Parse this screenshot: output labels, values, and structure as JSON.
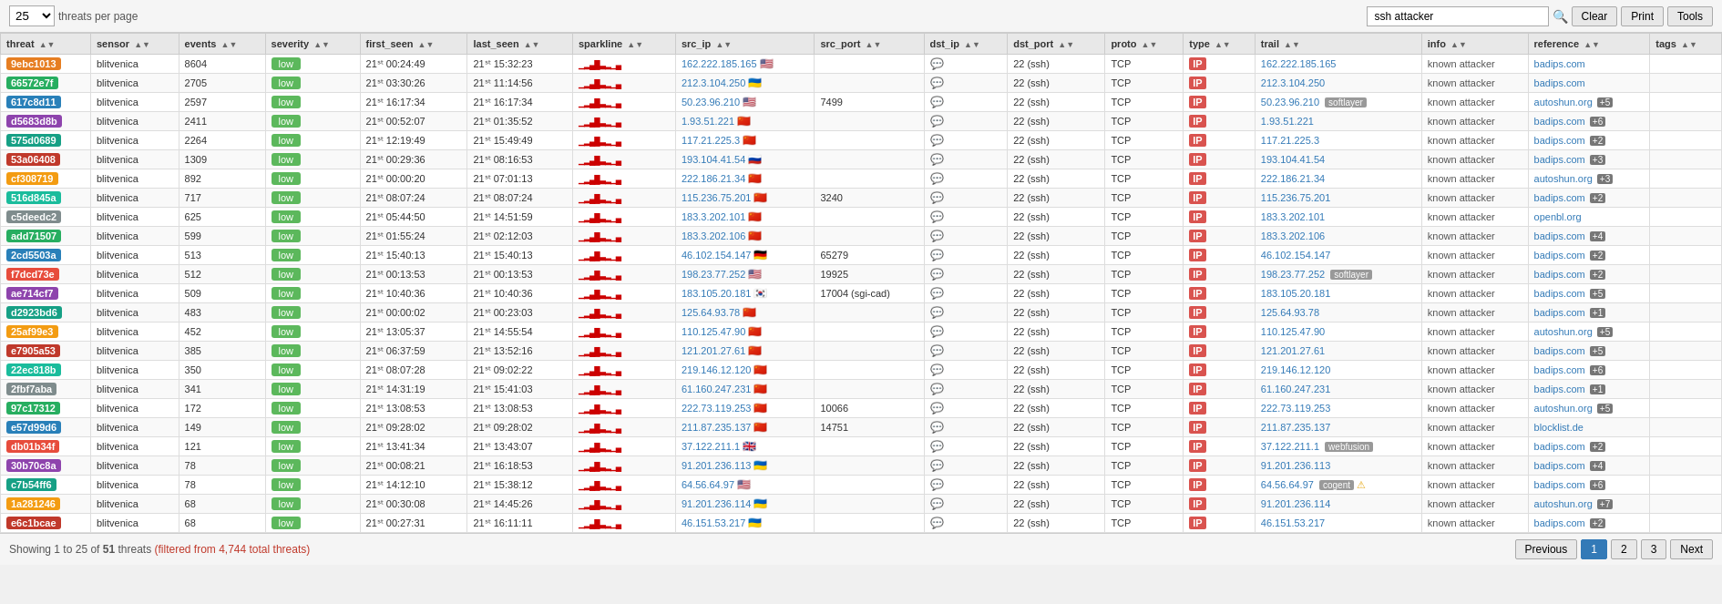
{
  "topbar": {
    "per_page_value": "25",
    "per_page_label": "threats per page",
    "search_placeholder": "ssh attacker",
    "search_value": "ssh attacker",
    "btn_clear": "Clear",
    "btn_print": "Print",
    "btn_tools": "Tools"
  },
  "columns": [
    {
      "key": "threat",
      "label": "threat"
    },
    {
      "key": "sensor",
      "label": "sensor"
    },
    {
      "key": "events",
      "label": "events"
    },
    {
      "key": "severity",
      "label": "severity"
    },
    {
      "key": "first_seen",
      "label": "first_seen"
    },
    {
      "key": "last_seen",
      "label": "last_seen"
    },
    {
      "key": "sparkline",
      "label": "sparkline"
    },
    {
      "key": "src_ip",
      "label": "src_ip"
    },
    {
      "key": "src_port",
      "label": "src_port"
    },
    {
      "key": "dst_ip",
      "label": "dst_ip"
    },
    {
      "key": "dst_port",
      "label": "dst_port"
    },
    {
      "key": "proto",
      "label": "proto"
    },
    {
      "key": "type",
      "label": "type"
    },
    {
      "key": "trail",
      "label": "trail"
    },
    {
      "key": "info",
      "label": "info"
    },
    {
      "key": "reference",
      "label": "reference"
    },
    {
      "key": "tags",
      "label": "tags"
    }
  ],
  "rows": [
    {
      "threat": "9ebc1013",
      "threat_color": "#e67e22",
      "sensor": "blitvenica",
      "events": "8604",
      "severity": "low",
      "first_seen": "21ˢᵗ 00:24:49",
      "last_seen": "21ˢᵗ 15:32:23",
      "src_ip": "162.222.185.165",
      "src_ip_flag": "US",
      "src_port": "",
      "dst_ip": "",
      "dst_port": "22 (ssh)",
      "proto": "TCP",
      "trail": "162.222.185.165",
      "info": "known attacker",
      "reference": "badips.com",
      "ref_extra": ""
    },
    {
      "threat": "66572e7f",
      "threat_color": "#27ae60",
      "sensor": "blitvenica",
      "events": "2705",
      "severity": "low",
      "first_seen": "21ˢᵗ 03:30:26",
      "last_seen": "21ˢᵗ 11:14:56",
      "src_ip": "212.3.104.250",
      "src_ip_flag": "UA",
      "src_port": "",
      "dst_ip": "",
      "dst_port": "22 (ssh)",
      "proto": "TCP",
      "trail": "212.3.104.250",
      "info": "known attacker",
      "reference": "badips.com",
      "ref_extra": ""
    },
    {
      "threat": "617c8d11",
      "threat_color": "#2980b9",
      "sensor": "blitvenica",
      "events": "2597",
      "severity": "low",
      "first_seen": "21ˢᵗ 16:17:34",
      "last_seen": "21ˢᵗ 16:17:34",
      "src_ip": "50.23.96.210",
      "src_ip_flag": "US",
      "src_port": "7499",
      "dst_ip": "",
      "dst_port": "22 (ssh)",
      "proto": "TCP",
      "trail": "50.23.96.210",
      "trail_badge": "softlayer",
      "info": "known attacker",
      "reference": "autoshun.org",
      "ref_extra": "+5"
    },
    {
      "threat": "d5683d8b",
      "threat_color": "#8e44ad",
      "sensor": "blitvenica",
      "events": "2411",
      "severity": "low",
      "first_seen": "21ˢᵗ 00:52:07",
      "last_seen": "21ˢᵗ 01:35:52",
      "src_ip": "1.93.51.221",
      "src_ip_flag": "CN",
      "src_port": "",
      "dst_ip": "",
      "dst_port": "22 (ssh)",
      "proto": "TCP",
      "trail": "1.93.51.221",
      "info": "known attacker",
      "reference": "badips.com",
      "ref_extra": "+6"
    },
    {
      "threat": "575d0689",
      "threat_color": "#16a085",
      "sensor": "blitvenica",
      "events": "2264",
      "severity": "low",
      "first_seen": "21ˢᵗ 12:19:49",
      "last_seen": "21ˢᵗ 15:49:49",
      "src_ip": "117.21.225.3",
      "src_ip_flag": "CN",
      "src_port": "",
      "dst_ip": "",
      "dst_port": "22 (ssh)",
      "proto": "TCP",
      "trail": "117.21.225.3",
      "info": "known attacker",
      "reference": "badips.com",
      "ref_extra": "+2"
    },
    {
      "threat": "53a06408",
      "threat_color": "#c0392b",
      "sensor": "blitvenica",
      "events": "1309",
      "severity": "low",
      "first_seen": "21ˢᵗ 00:29:36",
      "last_seen": "21ˢᵗ 08:16:53",
      "src_ip": "193.104.41.54",
      "src_ip_flag": "RU",
      "src_port": "",
      "dst_ip": "",
      "dst_port": "22 (ssh)",
      "proto": "TCP",
      "trail": "193.104.41.54",
      "info": "known attacker",
      "reference": "badips.com",
      "ref_extra": "+3"
    },
    {
      "threat": "cf308719",
      "threat_color": "#f39c12",
      "sensor": "blitvenica",
      "events": "892",
      "severity": "low",
      "first_seen": "21ˢᵗ 00:00:20",
      "last_seen": "21ˢᵗ 07:01:13",
      "src_ip": "222.186.21.34",
      "src_ip_flag": "CN",
      "src_port": "",
      "dst_ip": "",
      "dst_port": "22 (ssh)",
      "proto": "TCP",
      "trail": "222.186.21.34",
      "info": "known attacker",
      "reference": "autoshun.org",
      "ref_extra": "+3"
    },
    {
      "threat": "516d845a",
      "threat_color": "#1abc9c",
      "sensor": "blitvenica",
      "events": "717",
      "severity": "low",
      "first_seen": "21ˢᵗ 08:07:24",
      "last_seen": "21ˢᵗ 08:07:24",
      "src_ip": "115.236.75.201",
      "src_ip_flag": "CN",
      "src_port": "3240",
      "dst_ip": "",
      "dst_port": "22 (ssh)",
      "proto": "TCP",
      "trail": "115.236.75.201",
      "info": "known attacker",
      "reference": "badips.com",
      "ref_extra": "+2"
    },
    {
      "threat": "c5deedc2",
      "threat_color": "#7f8c8d",
      "sensor": "blitvenica",
      "events": "625",
      "severity": "low",
      "first_seen": "21ˢᵗ 05:44:50",
      "last_seen": "21ˢᵗ 14:51:59",
      "src_ip": "183.3.202.101",
      "src_ip_flag": "CN",
      "src_port": "",
      "dst_ip": "",
      "dst_port": "22 (ssh)",
      "proto": "TCP",
      "trail": "183.3.202.101",
      "info": "known attacker",
      "reference": "openbl.org",
      "ref_extra": ""
    },
    {
      "threat": "add71507",
      "threat_color": "#27ae60",
      "sensor": "blitvenica",
      "events": "599",
      "severity": "low",
      "first_seen": "21ˢᵗ 01:55:24",
      "last_seen": "21ˢᵗ 02:12:03",
      "src_ip": "183.3.202.106",
      "src_ip_flag": "CN",
      "src_port": "",
      "dst_ip": "",
      "dst_port": "22 (ssh)",
      "proto": "TCP",
      "trail": "183.3.202.106",
      "info": "known attacker",
      "reference": "badips.com",
      "ref_extra": "+4"
    },
    {
      "threat": "2cd5503a",
      "threat_color": "#2980b9",
      "sensor": "blitvenica",
      "events": "513",
      "severity": "low",
      "first_seen": "21ˢᵗ 15:40:13",
      "last_seen": "21ˢᵗ 15:40:13",
      "src_ip": "46.102.154.147",
      "src_ip_flag": "DE",
      "src_port": "65279",
      "dst_ip": "",
      "dst_port": "22 (ssh)",
      "proto": "TCP",
      "trail": "46.102.154.147",
      "info": "known attacker",
      "reference": "badips.com",
      "ref_extra": "+2"
    },
    {
      "threat": "f7dcd73e",
      "threat_color": "#e74c3c",
      "sensor": "blitvenica",
      "events": "512",
      "severity": "low",
      "first_seen": "21ˢᵗ 00:13:53",
      "last_seen": "21ˢᵗ 00:13:53",
      "src_ip": "198.23.77.252",
      "src_ip_flag": "US",
      "src_port": "19925",
      "dst_ip": "",
      "dst_port": "22 (ssh)",
      "proto": "TCP",
      "trail": "198.23.77.252",
      "trail_badge": "softlayer",
      "info": "known attacker",
      "reference": "badips.com",
      "ref_extra": "+2"
    },
    {
      "threat": "ae714cf7",
      "threat_color": "#8e44ad",
      "sensor": "blitvenica",
      "events": "509",
      "severity": "low",
      "first_seen": "21ˢᵗ 10:40:36",
      "last_seen": "21ˢᵗ 10:40:36",
      "src_ip": "183.105.20.181",
      "src_ip_flag": "KR",
      "src_port": "17004 (sgi-cad)",
      "dst_ip": "",
      "dst_port": "22 (ssh)",
      "proto": "TCP",
      "trail": "183.105.20.181",
      "info": "known attacker",
      "reference": "badips.com",
      "ref_extra": "+5"
    },
    {
      "threat": "d2923bd6",
      "threat_color": "#16a085",
      "sensor": "blitvenica",
      "events": "483",
      "severity": "low",
      "first_seen": "21ˢᵗ 00:00:02",
      "last_seen": "21ˢᵗ 00:23:03",
      "src_ip": "125.64.93.78",
      "src_ip_flag": "CN",
      "src_port": "",
      "dst_ip": "",
      "dst_port": "22 (ssh)",
      "proto": "TCP",
      "trail": "125.64.93.78",
      "info": "known attacker",
      "reference": "badips.com",
      "ref_extra": "+1"
    },
    {
      "threat": "25af99e3",
      "threat_color": "#f39c12",
      "sensor": "blitvenica",
      "events": "452",
      "severity": "low",
      "first_seen": "21ˢᵗ 13:05:37",
      "last_seen": "21ˢᵗ 14:55:54",
      "src_ip": "110.125.47.90",
      "src_ip_flag": "CN",
      "src_port": "",
      "dst_ip": "",
      "dst_port": "22 (ssh)",
      "proto": "TCP",
      "trail": "110.125.47.90",
      "info": "known attacker",
      "reference": "autoshun.org",
      "ref_extra": "+5"
    },
    {
      "threat": "e7905a53",
      "threat_color": "#c0392b",
      "sensor": "blitvenica",
      "events": "385",
      "severity": "low",
      "first_seen": "21ˢᵗ 06:37:59",
      "last_seen": "21ˢᵗ 13:52:16",
      "src_ip": "121.201.27.61",
      "src_ip_flag": "CN",
      "src_port": "",
      "dst_ip": "",
      "dst_port": "22 (ssh)",
      "proto": "TCP",
      "trail": "121.201.27.61",
      "info": "known attacker",
      "reference": "badips.com",
      "ref_extra": "+5"
    },
    {
      "threat": "22ec818b",
      "threat_color": "#1abc9c",
      "sensor": "blitvenica",
      "events": "350",
      "severity": "low",
      "first_seen": "21ˢᵗ 08:07:28",
      "last_seen": "21ˢᵗ 09:02:22",
      "src_ip": "219.146.12.120",
      "src_ip_flag": "CN",
      "src_port": "",
      "dst_ip": "",
      "dst_port": "22 (ssh)",
      "proto": "TCP",
      "trail": "219.146.12.120",
      "info": "known attacker",
      "reference": "badips.com",
      "ref_extra": "+6"
    },
    {
      "threat": "2fbf7aba",
      "threat_color": "#7f8c8d",
      "sensor": "blitvenica",
      "events": "341",
      "severity": "low",
      "first_seen": "21ˢᵗ 14:31:19",
      "last_seen": "21ˢᵗ 15:41:03",
      "src_ip": "61.160.247.231",
      "src_ip_flag": "CN",
      "src_port": "",
      "dst_ip": "",
      "dst_port": "22 (ssh)",
      "proto": "TCP",
      "trail": "61.160.247.231",
      "info": "known attacker",
      "reference": "badips.com",
      "ref_extra": "+1"
    },
    {
      "threat": "97c17312",
      "threat_color": "#27ae60",
      "sensor": "blitvenica",
      "events": "172",
      "severity": "low",
      "first_seen": "21ˢᵗ 13:08:53",
      "last_seen": "21ˢᵗ 13:08:53",
      "src_ip": "222.73.119.253",
      "src_ip_flag": "CN",
      "src_port": "10066",
      "dst_ip": "",
      "dst_port": "22 (ssh)",
      "proto": "TCP",
      "trail": "222.73.119.253",
      "info": "known attacker",
      "reference": "autoshun.org",
      "ref_extra": "+5"
    },
    {
      "threat": "e57d99d6",
      "threat_color": "#2980b9",
      "sensor": "blitvenica",
      "events": "149",
      "severity": "low",
      "first_seen": "21ˢᵗ 09:28:02",
      "last_seen": "21ˢᵗ 09:28:02",
      "src_ip": "211.87.235.137",
      "src_ip_flag": "CN",
      "src_port": "14751",
      "dst_ip": "",
      "dst_port": "22 (ssh)",
      "proto": "TCP",
      "trail": "211.87.235.137",
      "info": "known attacker",
      "reference": "blocklist.de",
      "ref_extra": ""
    },
    {
      "threat": "db01b34f",
      "threat_color": "#e74c3c",
      "sensor": "blitvenica",
      "events": "121",
      "severity": "low",
      "first_seen": "21ˢᵗ 13:41:34",
      "last_seen": "21ˢᵗ 13:43:07",
      "src_ip": "37.122.211.1",
      "src_ip_flag": "GB",
      "src_port": "",
      "dst_ip": "",
      "dst_port": "22 (ssh)",
      "proto": "TCP",
      "trail": "37.122.211.1",
      "trail_badge": "webfusion",
      "info": "known attacker",
      "reference": "badips.com",
      "ref_extra": "+2"
    },
    {
      "threat": "30b70c8a",
      "threat_color": "#8e44ad",
      "sensor": "blitvenica",
      "events": "78",
      "severity": "low",
      "first_seen": "21ˢᵗ 00:08:21",
      "last_seen": "21ˢᵗ 16:18:53",
      "src_ip": "91.201.236.113",
      "src_ip_flag": "UA",
      "src_port": "",
      "dst_ip": "",
      "dst_port": "22 (ssh)",
      "proto": "TCP",
      "trail": "91.201.236.113",
      "info": "known attacker",
      "reference": "badips.com",
      "ref_extra": "+4"
    },
    {
      "threat": "c7b54ff6",
      "threat_color": "#16a085",
      "sensor": "blitvenica",
      "events": "78",
      "severity": "low",
      "first_seen": "21ˢᵗ 14:12:10",
      "last_seen": "21ˢᵗ 15:38:12",
      "src_ip": "64.56.64.97",
      "src_ip_flag": "US",
      "src_port": "",
      "dst_ip": "",
      "dst_port": "22 (ssh)",
      "proto": "TCP",
      "trail": "64.56.64.97",
      "trail_badge": "cogent",
      "trail_warn": true,
      "info": "known attacker",
      "reference": "badips.com",
      "ref_extra": "+6"
    },
    {
      "threat": "1a281246",
      "threat_color": "#f39c12",
      "sensor": "blitvenica",
      "events": "68",
      "severity": "low",
      "first_seen": "21ˢᵗ 00:30:08",
      "last_seen": "21ˢᵗ 14:45:26",
      "src_ip": "91.201.236.114",
      "src_ip_flag": "UA",
      "src_port": "",
      "dst_ip": "",
      "dst_port": "22 (ssh)",
      "proto": "TCP",
      "trail": "91.201.236.114",
      "info": "known attacker",
      "reference": "autoshun.org",
      "ref_extra": "+7"
    },
    {
      "threat": "e6c1bcae",
      "threat_color": "#c0392b",
      "sensor": "blitvenica",
      "events": "68",
      "severity": "low",
      "first_seen": "21ˢᵗ 00:27:31",
      "last_seen": "21ˢᵗ 16:11:11",
      "src_ip": "46.151.53.217",
      "src_ip_flag": "UA",
      "src_port": "",
      "dst_ip": "",
      "dst_port": "22 (ssh)",
      "proto": "TCP",
      "trail": "46.151.53.217",
      "info": "known attacker",
      "reference": "badips.com",
      "ref_extra": "+2"
    }
  ],
  "footer": {
    "showing": "Showing 1 to 25 of",
    "total": "51",
    "threats_label": "threats",
    "filtered_label": "(filtered from 4,744 total threats)",
    "prev_label": "Previous",
    "next_label": "Next",
    "pages": [
      "1",
      "2",
      "3"
    ]
  }
}
